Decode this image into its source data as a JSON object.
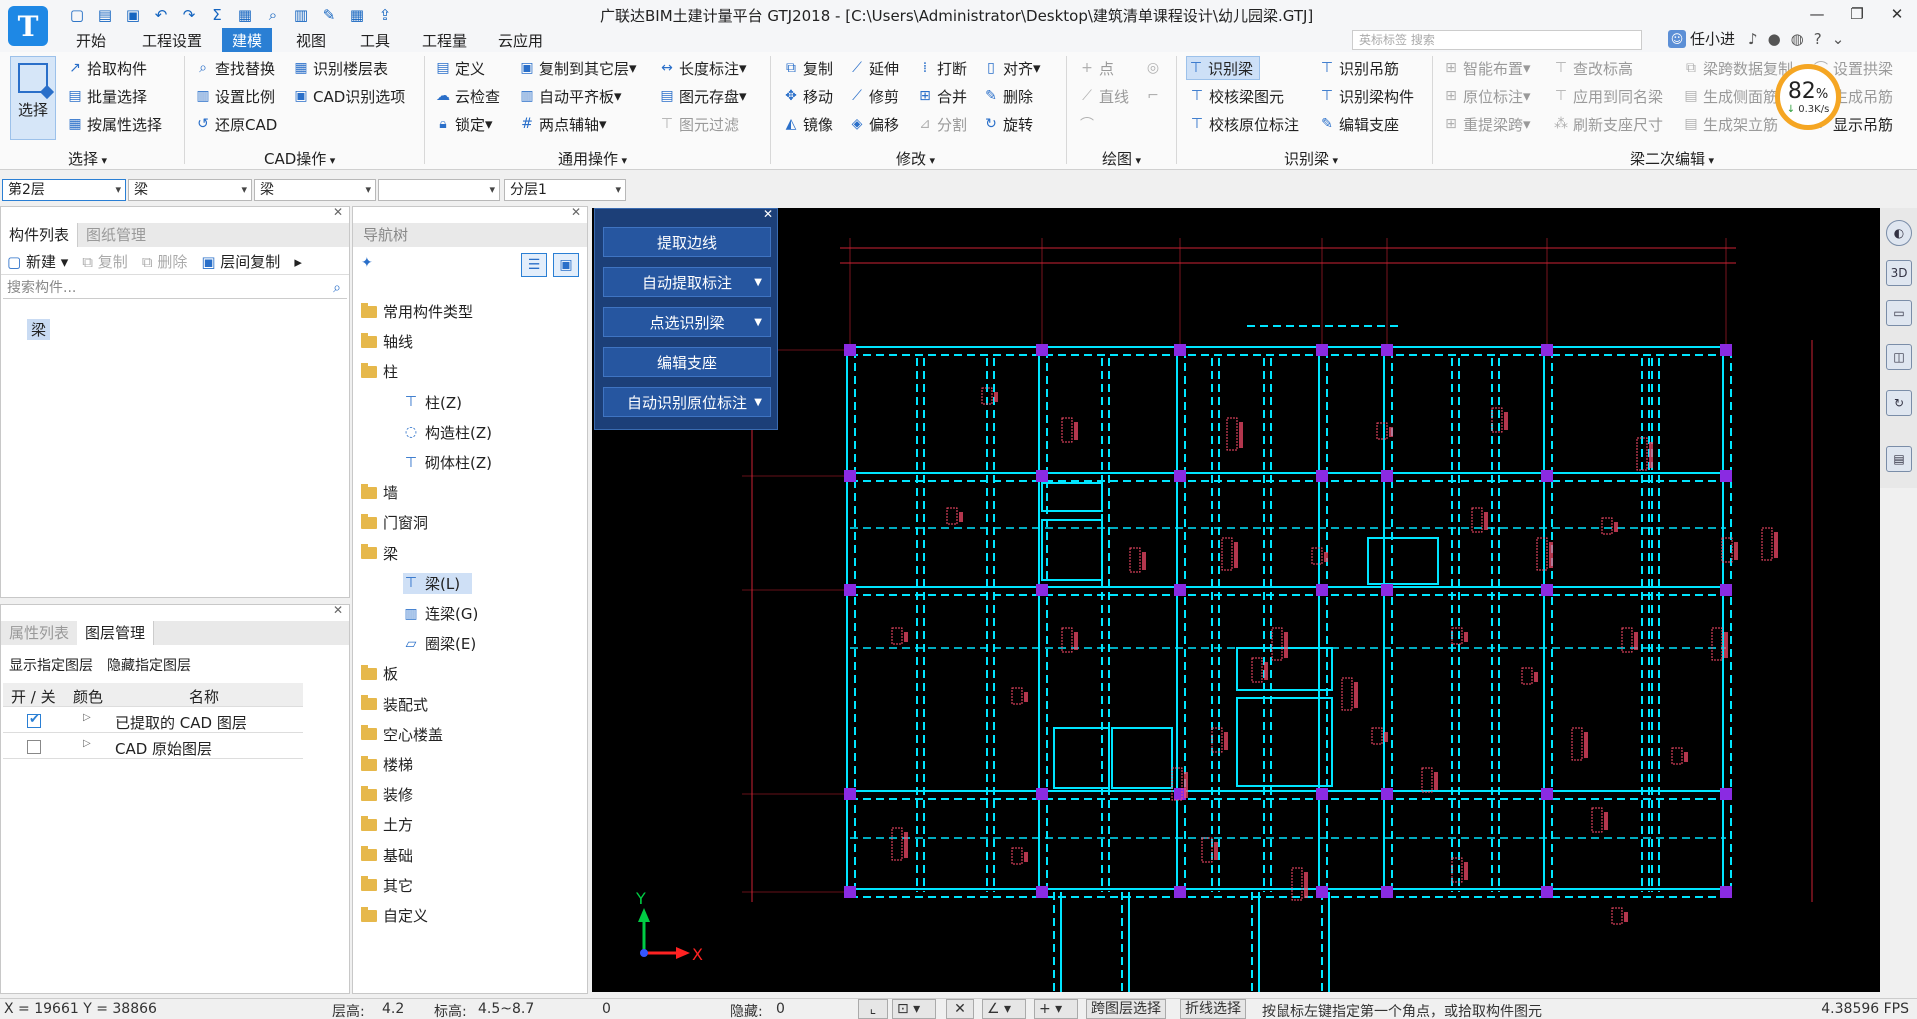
{
  "app": {
    "title": "广联达BIM土建计量平台 GTJ2018 - [C:\\Users\\Administrator\\Desktop\\建筑清单课程设计\\幼儿园梁.GTJ]",
    "logo_letter": "T",
    "user": "任小进",
    "project_search_placeholder": "英标标签 搜索"
  },
  "menu": [
    "开始",
    "工程设置",
    "建模",
    "视图",
    "工具",
    "工程量",
    "云应用"
  ],
  "ribbon": {
    "select_label": "选择",
    "groups": {
      "select": "选择",
      "cad": "CAD操作",
      "common": "通用操作",
      "modify": "修改",
      "draw": "绘图",
      "recog": "识别梁",
      "beam2": "梁二次编辑"
    },
    "select_items": [
      "拾取构件",
      "批量选择",
      "按属性选择"
    ],
    "cad_items": [
      "查找替换",
      "识别楼层表",
      "设置比例",
      "CAD识别选项",
      "还原CAD"
    ],
    "common_items": [
      "定义",
      "复制到其它层",
      "长度标注",
      "云检查",
      "自动平齐板",
      "图元存盘",
      "锁定",
      "两点辅轴",
      "图元过滤"
    ],
    "modify_items": [
      "复制",
      "延伸",
      "打断",
      "对齐",
      "移动",
      "修剪",
      "合并",
      "删除",
      "镜像",
      "偏移",
      "分割",
      "旋转"
    ],
    "draw_items": [
      "点",
      "直线"
    ],
    "recog_items": [
      "识别梁",
      "识别吊筋",
      "校核梁图元",
      "识别梁构件",
      "校核原位标注",
      "编辑支座"
    ],
    "beam2_items": [
      "智能布置",
      "查改标高",
      "梁跨数据复制",
      "设置拱梁",
      "原位标注",
      "应用到同名梁",
      "生成侧面筋",
      "生成吊筋",
      "重提梁跨",
      "刷新支座尺寸",
      "生成架立筋",
      "显示吊筋"
    ]
  },
  "perf": {
    "percent": "82",
    "unit": "%",
    "speed": "0.3K/s"
  },
  "filters": {
    "floor": "第2层",
    "type": "梁",
    "subtype": "梁",
    "blank": "",
    "layer": "分层1"
  },
  "component_panel": {
    "tabs": [
      "构件列表",
      "图纸管理"
    ],
    "toolbar": [
      "新建",
      "复制",
      "删除",
      "层间复制"
    ],
    "search_placeholder": "搜索构件...",
    "items": [
      "梁"
    ]
  },
  "layer_panel": {
    "tabs": [
      "属性列表",
      "图层管理"
    ],
    "actions": [
      "显示指定图层",
      "隐藏指定图层"
    ],
    "columns": [
      "开 / 关",
      "颜色",
      "名称"
    ],
    "rows": [
      {
        "on": true,
        "name": "已提取的 CAD 图层"
      },
      {
        "on": false,
        "name": "CAD 原始图层"
      }
    ]
  },
  "nav_tree": {
    "title": "导航树",
    "items": [
      {
        "label": "常用构件类型",
        "level": 0
      },
      {
        "label": "轴线",
        "level": 0
      },
      {
        "label": "柱",
        "level": 0
      },
      {
        "label": "柱(Z)",
        "level": 1,
        "icon": "column-icon"
      },
      {
        "label": "构造柱(Z)",
        "level": 1,
        "icon": "construct-column-icon"
      },
      {
        "label": "砌体柱(Z)",
        "level": 1,
        "icon": "masonry-column-icon"
      },
      {
        "label": "墙",
        "level": 0
      },
      {
        "label": "门窗洞",
        "level": 0
      },
      {
        "label": "梁",
        "level": 0
      },
      {
        "label": "梁(L)",
        "level": 1,
        "icon": "beam-icon",
        "selected": true
      },
      {
        "label": "连梁(G)",
        "level": 1,
        "icon": "link-beam-icon"
      },
      {
        "label": "圈梁(E)",
        "level": 1,
        "icon": "ring-beam-icon"
      },
      {
        "label": "板",
        "level": 0
      },
      {
        "label": "装配式",
        "level": 0
      },
      {
        "label": "空心楼盖",
        "level": 0
      },
      {
        "label": "楼梯",
        "level": 0
      },
      {
        "label": "装修",
        "level": 0
      },
      {
        "label": "土方",
        "level": 0
      },
      {
        "label": "基础",
        "level": 0
      },
      {
        "label": "其它",
        "level": 0
      },
      {
        "label": "自定义",
        "level": 0
      }
    ]
  },
  "recog_panel": {
    "buttons": [
      {
        "label": "提取边线",
        "dropdown": false
      },
      {
        "label": "自动提取标注",
        "dropdown": true
      },
      {
        "label": "点选识别梁",
        "dropdown": true
      },
      {
        "label": "编辑支座",
        "dropdown": false
      },
      {
        "label": "自动识别原位标注",
        "dropdown": true
      }
    ]
  },
  "canvas": {
    "axis_x": "X",
    "axis_y": "Y",
    "bg": "#000000",
    "beam_color": "#00e5ff",
    "column_color": "#8a2be2",
    "annotation_color": "#ff4d6d",
    "dim_color": "#cc2233"
  },
  "status": {
    "coords": "X = 19661 Y = 38866",
    "floor_height": "层高:",
    "floor_height_val": "4.2",
    "elevation": "标高:",
    "elevation_val": "4.5~8.7",
    "zero": "0",
    "hidden": "隐藏:",
    "hidden_val": "0",
    "cross_layer": "跨图层选择",
    "polyline": "折线选择",
    "hint": "按鼠标左键指定第一个角点，或拾取构件图元",
    "fps": "4.38596 FPS"
  }
}
